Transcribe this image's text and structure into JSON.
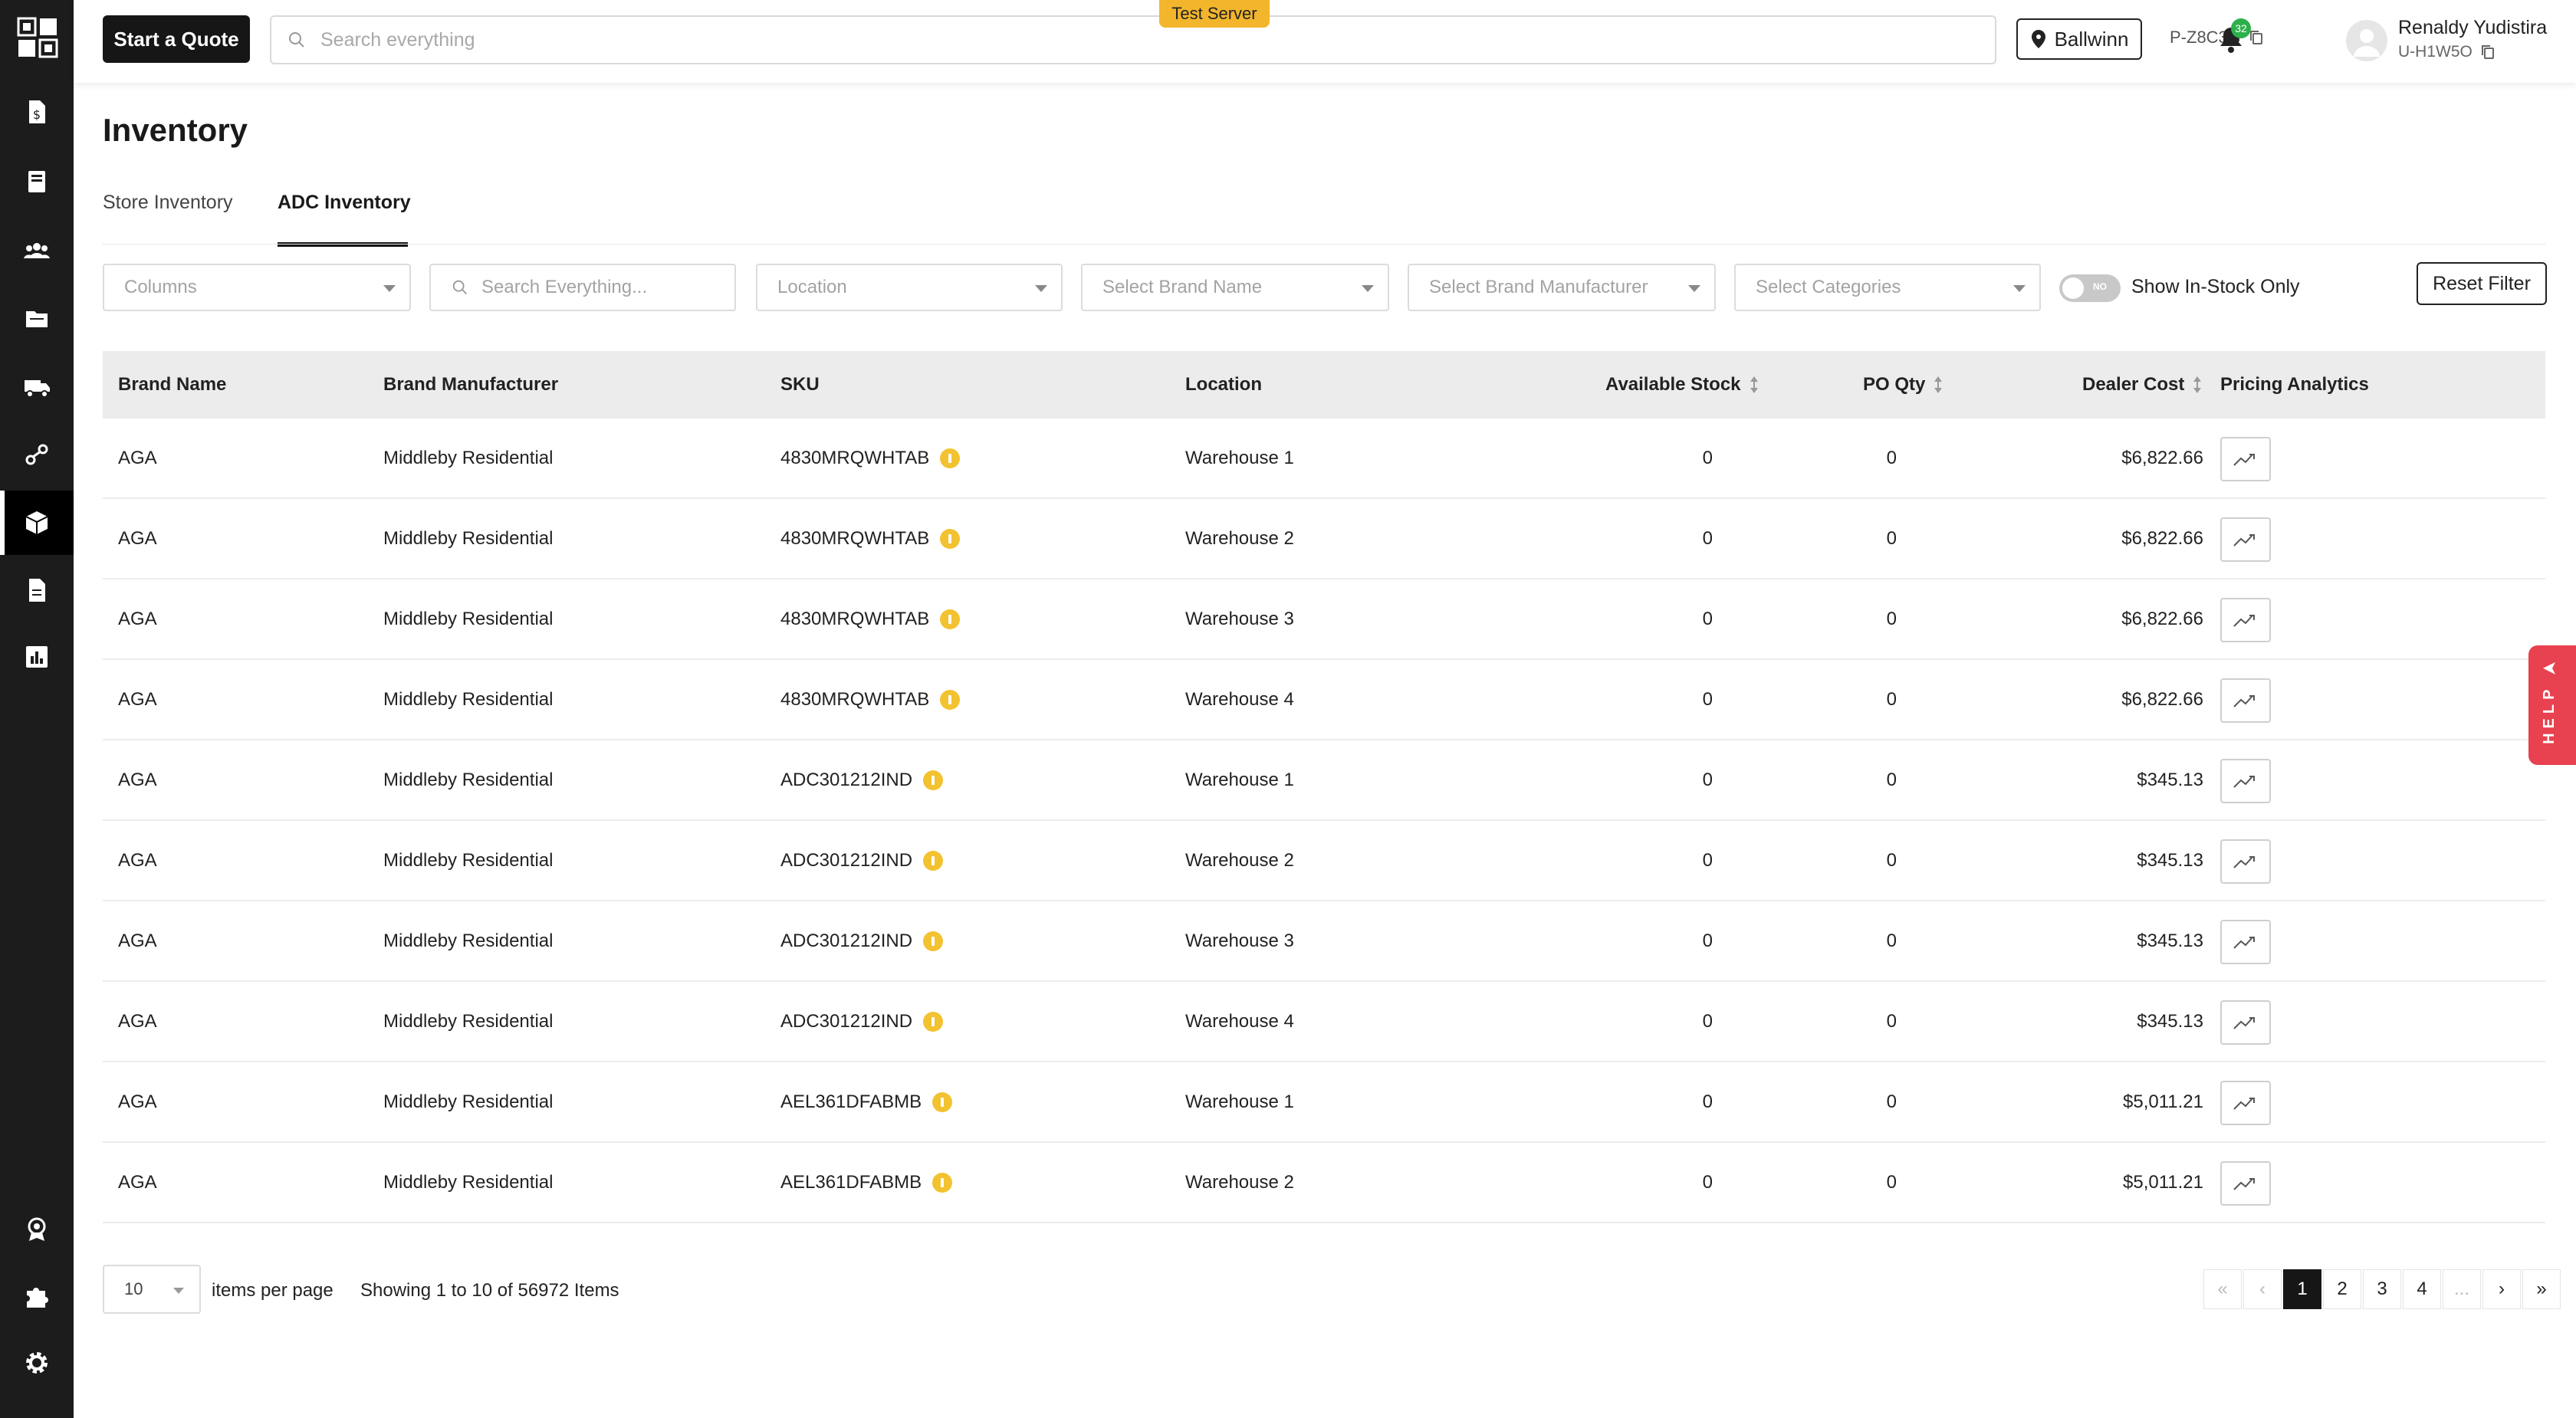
{
  "header": {
    "quote_button": "Start a Quote",
    "search_placeholder": "Search everything",
    "server_badge": "Test Server",
    "location": "Ballwinn",
    "project_code": "P-Z8C3G",
    "notification_count": "32",
    "user_name": "Renaldy Yudistira",
    "user_id": "U-H1W5O"
  },
  "sidebar": {
    "icons": [
      "dollar-document-icon",
      "book-icon",
      "users-icon",
      "folder-icon",
      "truck-icon",
      "connection-icon",
      "box-icon",
      "document-icon",
      "bar-chart-icon",
      "award-icon",
      "puzzle-icon",
      "gear-icon"
    ],
    "active": "box-icon"
  },
  "page": {
    "title": "Inventory",
    "tabs": [
      "Store Inventory",
      "ADC Inventory"
    ],
    "active_tab": "ADC Inventory"
  },
  "filters": {
    "columns": "Columns",
    "search_placeholder": "Search Everything...",
    "location": "Location",
    "brand_name": "Select Brand Name",
    "brand_manufacturer": "Select Brand Manufacturer",
    "categories": "Select Categories",
    "toggle_state": "NO",
    "toggle_label": "Show In-Stock Only",
    "reset": "Reset Filter"
  },
  "table": {
    "headers": [
      "Brand Name",
      "Brand Manufacturer",
      "SKU",
      "Location",
      "Available Stock",
      "PO Qty",
      "Dealer Cost",
      "Pricing Analytics"
    ],
    "rows": [
      {
        "brand": "AGA",
        "manufacturer": "Middleby Residential",
        "sku": "4830MRQWHTAB",
        "location": "Warehouse 1",
        "stock": "0",
        "po": "0",
        "cost": "$6,822.66"
      },
      {
        "brand": "AGA",
        "manufacturer": "Middleby Residential",
        "sku": "4830MRQWHTAB",
        "location": "Warehouse 2",
        "stock": "0",
        "po": "0",
        "cost": "$6,822.66"
      },
      {
        "brand": "AGA",
        "manufacturer": "Middleby Residential",
        "sku": "4830MRQWHTAB",
        "location": "Warehouse 3",
        "stock": "0",
        "po": "0",
        "cost": "$6,822.66"
      },
      {
        "brand": "AGA",
        "manufacturer": "Middleby Residential",
        "sku": "4830MRQWHTAB",
        "location": "Warehouse 4",
        "stock": "0",
        "po": "0",
        "cost": "$6,822.66"
      },
      {
        "brand": "AGA",
        "manufacturer": "Middleby Residential",
        "sku": "ADC301212IND",
        "location": "Warehouse 1",
        "stock": "0",
        "po": "0",
        "cost": "$345.13"
      },
      {
        "brand": "AGA",
        "manufacturer": "Middleby Residential",
        "sku": "ADC301212IND",
        "location": "Warehouse 2",
        "stock": "0",
        "po": "0",
        "cost": "$345.13"
      },
      {
        "brand": "AGA",
        "manufacturer": "Middleby Residential",
        "sku": "ADC301212IND",
        "location": "Warehouse 3",
        "stock": "0",
        "po": "0",
        "cost": "$345.13"
      },
      {
        "brand": "AGA",
        "manufacturer": "Middleby Residential",
        "sku": "ADC301212IND",
        "location": "Warehouse 4",
        "stock": "0",
        "po": "0",
        "cost": "$345.13"
      },
      {
        "brand": "AGA",
        "manufacturer": "Middleby Residential",
        "sku": "AEL361DFABMB",
        "location": "Warehouse 1",
        "stock": "0",
        "po": "0",
        "cost": "$5,011.21"
      },
      {
        "brand": "AGA",
        "manufacturer": "Middleby Residential",
        "sku": "AEL361DFABMB",
        "location": "Warehouse 2",
        "stock": "0",
        "po": "0",
        "cost": "$5,011.21"
      }
    ]
  },
  "pagination": {
    "per_page": "10",
    "per_page_label": "items per page",
    "showing": "Showing 1 to 10 of 56972 Items",
    "first": "«",
    "prev": "‹",
    "pages": [
      "1",
      "2",
      "3",
      "4"
    ],
    "ellipsis": "...",
    "next": "›",
    "last": "»",
    "current": "1"
  },
  "help": {
    "label": "HELP"
  }
}
